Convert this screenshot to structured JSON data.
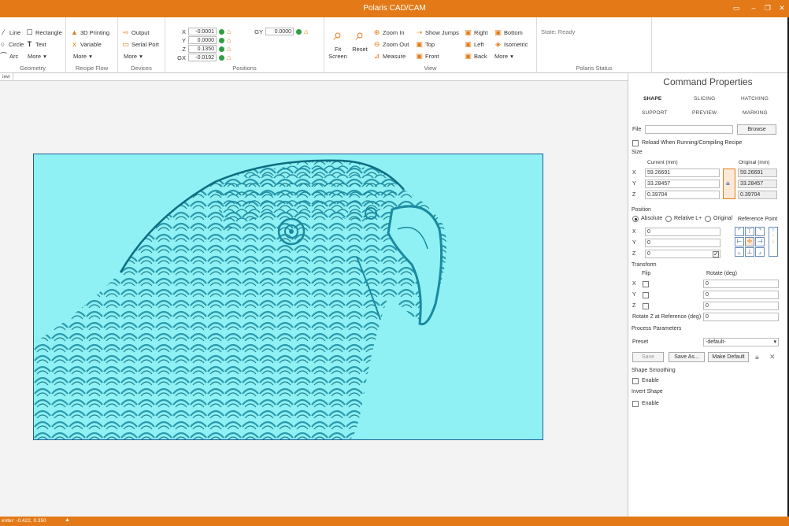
{
  "app": {
    "title": "Polaris CAD/CAM"
  },
  "colors": {
    "accent": "#e37a17",
    "canvas_bg": "#8ff1f3",
    "line": "#1a8aa0"
  },
  "ribbon": {
    "geometry": {
      "label": "Geometry",
      "line": "Line",
      "rectangle": "Rectangle",
      "circle": "Circle",
      "text": "Text",
      "arc": "Arc",
      "more": "More"
    },
    "recipe_flow": {
      "label": "Recipe Flow",
      "printing3d": "3D Printing",
      "variable": "Variable",
      "more": "More"
    },
    "devices": {
      "label": "Devices",
      "output": "Output",
      "serial_port": "Serial Port",
      "more": "More"
    },
    "positions": {
      "label": "Positions",
      "x_label": "X",
      "x_value": "-0.0001",
      "y_label": "Y",
      "y_value": "0.0000",
      "z_label": "Z",
      "z_value": "0.1350",
      "gx_label": "GX",
      "gx_value": "-0.0192",
      "gy_label": "GY",
      "gy_value": "0.0000"
    },
    "view": {
      "label": "View",
      "fit_screen": "Fit Screen",
      "reset": "Reset",
      "zoom_in": "Zoom In",
      "zoom_out": "Zoom Out",
      "measure": "Measure",
      "show_jumps": "Show Jumps",
      "top": "Top",
      "front": "Front",
      "right": "Right",
      "left": "Left",
      "back": "Back",
      "bottom": "Bottom",
      "isometric": "Isometric",
      "more": "More"
    },
    "status": {
      "label": "Polaris Status",
      "state": "State: Ready"
    }
  },
  "doc_tab": {
    "label": "iew"
  },
  "panel": {
    "title": "Command Properties",
    "tabs": [
      "SHAPE",
      "SLICING",
      "HATCHING",
      "SUPPORT",
      "PREVIEW",
      "MARKING"
    ],
    "file_label": "File",
    "file_value": "",
    "browse": "Browse",
    "reload_label": "Reload When Running/Compiling Recipe",
    "size": {
      "label": "Size",
      "current_header": "Current (mm)",
      "original_header": "Original (mm)",
      "x_label": "X",
      "y_label": "Y",
      "z_label": "Z",
      "current_x": "59.26691",
      "current_y": "33.28457",
      "current_z": "0.39704",
      "original_x": "59.26691",
      "original_y": "33.28457",
      "original_z": "0.39704"
    },
    "position": {
      "label": "Position",
      "absolute": "Absolute",
      "relative": "Relative L+",
      "original": "Original",
      "reference_point": "Reference Point",
      "x_label": "X",
      "y_label": "Y",
      "z_label": "Z",
      "x": "0",
      "y": "0",
      "z": "0"
    },
    "transform": {
      "label": "Transform",
      "flip": "Flip",
      "rotate_deg": "Rotate (deg)",
      "x_label": "X",
      "y_label": "Y",
      "z_label": "Z",
      "rot_x": "0",
      "rot_y": "0",
      "rot_z": "0",
      "rotate_z_ref_label": "Rotate Z at Reference (deg)",
      "rotate_z_ref": "0"
    },
    "process": {
      "label": "Process Parameters",
      "preset_label": "Preset",
      "preset_value": "-default-",
      "save": "Save",
      "save_as": "Save As...",
      "make_default": "Make Default"
    },
    "smoothing": {
      "label": "Shape Smoothing",
      "enable": "Enable"
    },
    "invert": {
      "label": "Invert Shape",
      "enable": "Enable"
    }
  },
  "statusbar": {
    "coords": "enter: -0.422, 0.350"
  }
}
